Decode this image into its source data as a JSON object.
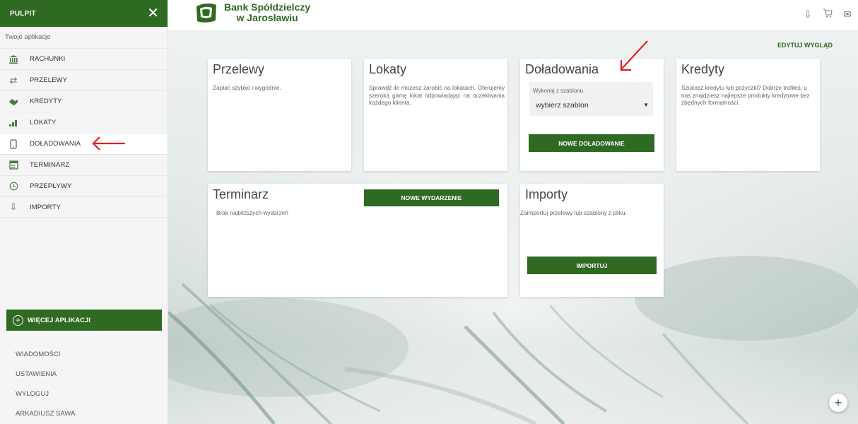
{
  "sidebar": {
    "title": "PULPIT",
    "close_icon": "close-icon",
    "subtitle": "Twoje aplikacje",
    "items": [
      {
        "label": "RACHUNKI",
        "icon": "bank-icon"
      },
      {
        "label": "PRZELEWY",
        "icon": "transfer-arrows-icon"
      },
      {
        "label": "KREDYTY",
        "icon": "handshake-icon"
      },
      {
        "label": "LOKATY",
        "icon": "coins-icon"
      },
      {
        "label": "DOŁADOWANIA",
        "icon": "phone-icon"
      },
      {
        "label": "TERMINARZ",
        "icon": "calendar-icon"
      },
      {
        "label": "PRZEPŁYWY",
        "icon": "clock-icon"
      },
      {
        "label": "IMPORTY",
        "icon": "import-arrow-icon"
      }
    ],
    "more_apps": "WIĘCEJ APLIKACJI",
    "bottom_links": [
      "WIADOMOŚCI",
      "USTAWIENIA",
      "WYLOGUJ",
      "ARKADIUSZ SAWA"
    ]
  },
  "header": {
    "bank_line1": "Bank Spółdzielczy",
    "bank_line2": "w Jarosławiu",
    "icons": [
      "download-icon",
      "cart-icon",
      "mail-icon"
    ]
  },
  "main": {
    "edit_link": "EDYTUJ WYGLĄD",
    "cards": {
      "przelewy": {
        "title": "Przelewy",
        "desc": "Zapłać szybko i wygodnie."
      },
      "lokaty": {
        "title": "Lokaty",
        "desc": "Sprawdź ile możesz zarobić na lokatach. Oferujemy szeroką gamę lokat odpowiadając na oczekiwania każdego klienta."
      },
      "doladowania": {
        "title": "Doładowania",
        "select_label": "Wykonaj z szablonu",
        "select_value": "wybierz szablon",
        "button": "NOWE DOŁADOWANIE"
      },
      "kredyty": {
        "title": "Kredyty",
        "desc": "Szukasz kredytu lub pożyczki? Dobrze trafiłeś, u nas znajdziesz najlepsze produkty kredytowe bez zbędnych formalności."
      },
      "terminarz": {
        "title": "Terminarz",
        "desc": "Brak najbliższych wydarzeń",
        "button": "NOWE WYDARZENIE"
      },
      "importy": {
        "title": "Importy",
        "desc": "Zaimportuj przelewy lub szablony z pliku.",
        "button": "IMPORTUJ"
      }
    },
    "fab": "+"
  },
  "colors": {
    "brand_green": "#2f6a22",
    "annotation_red": "#e02020"
  }
}
